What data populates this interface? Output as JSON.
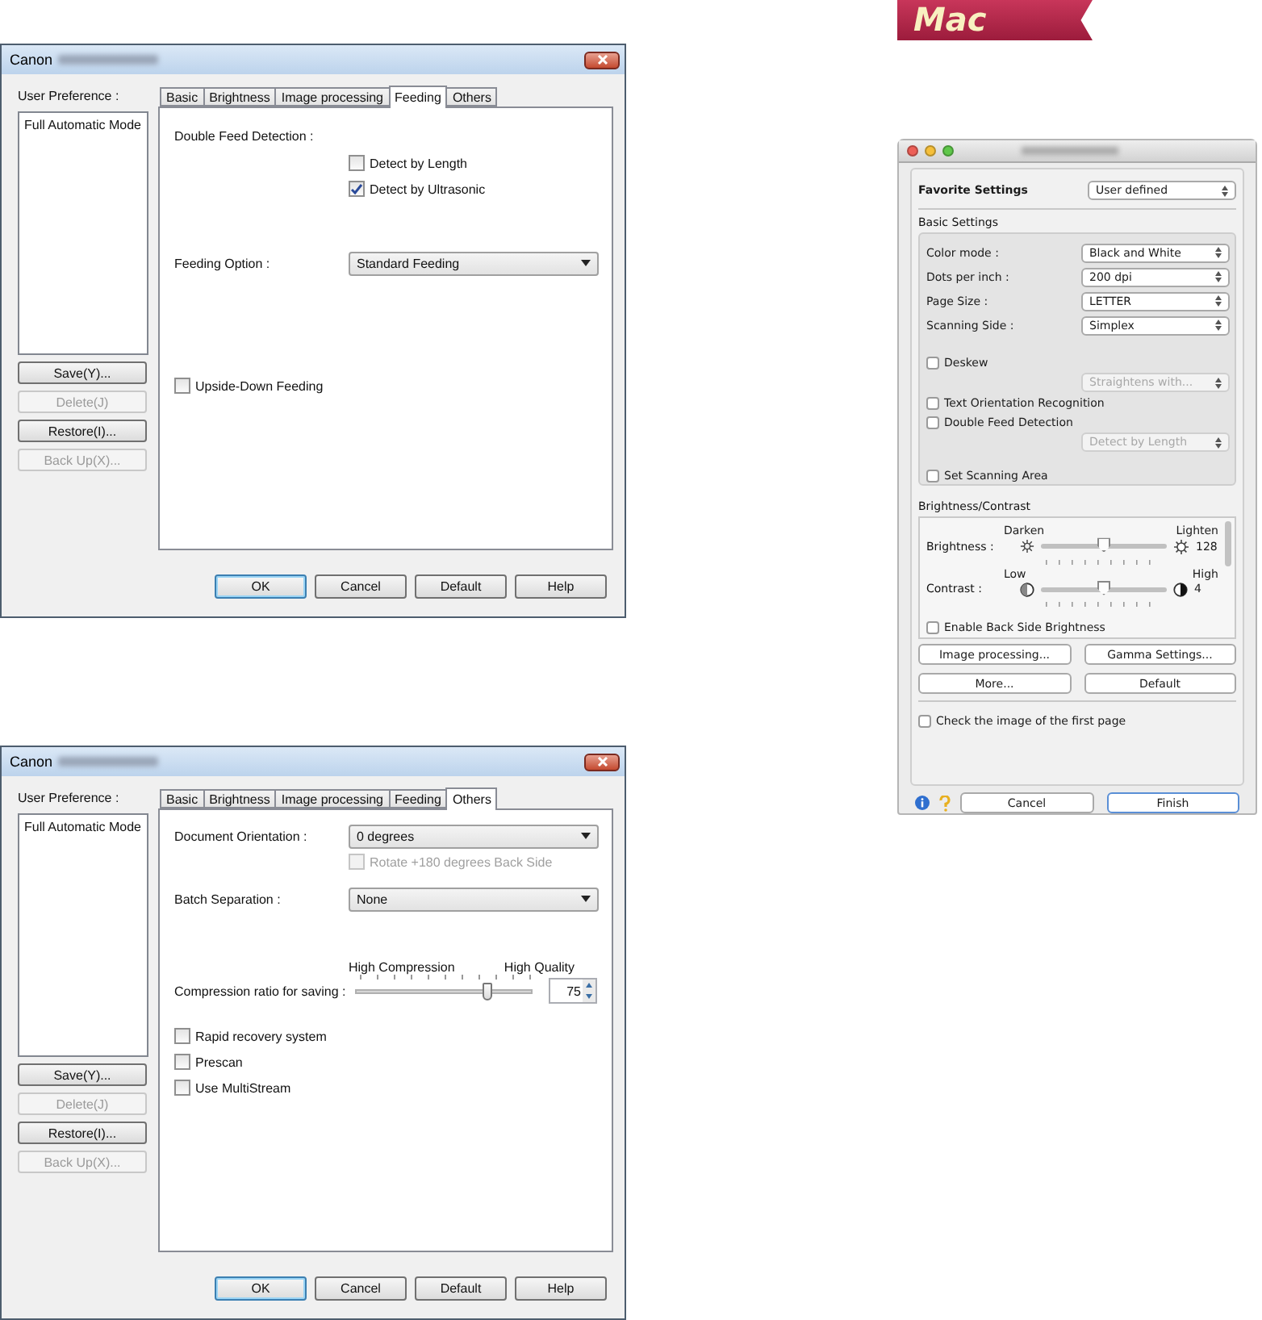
{
  "badge": {
    "label": "Mac"
  },
  "dialogs": [
    {
      "title": "Canon",
      "preference_label": "User Preference :",
      "preferences": [
        {
          "label": "Full Automatic Mode"
        }
      ],
      "side_buttons": [
        {
          "label": "Save(Y)...",
          "disabled": false
        },
        {
          "label": "Delete(J)",
          "disabled": true
        },
        {
          "label": "Restore(I)...",
          "disabled": false
        },
        {
          "label": "Back Up(X)...",
          "disabled": true
        }
      ],
      "tabs": [
        {
          "label": "Basic",
          "selected": false
        },
        {
          "label": "Brightness",
          "selected": false
        },
        {
          "label": "Image processing",
          "selected": false
        },
        {
          "label": "Feeding",
          "selected": true
        },
        {
          "label": "Others",
          "selected": false
        }
      ],
      "rows": [
        {
          "kind": "label",
          "label": "Double Feed Detection :"
        },
        {
          "kind": "option",
          "label": "Detect by Length",
          "checked": false,
          "disabled": false
        },
        {
          "kind": "option",
          "label": "Detect by Ultrasonic",
          "checked": true,
          "disabled": false
        },
        {
          "kind": "select",
          "label": "Feeding Option :",
          "value": "Standard Feeding"
        },
        {
          "kind": "checkbox",
          "label": "Upside-Down Feeding",
          "checked": false
        }
      ],
      "buttons": [
        {
          "label": "OK",
          "default": true
        },
        {
          "label": "Cancel",
          "default": false
        },
        {
          "label": "Default",
          "default": false
        },
        {
          "label": "Help",
          "default": false
        }
      ]
    },
    {
      "title": "Canon",
      "preference_label": "User Preference :",
      "preferences": [
        {
          "label": "Full Automatic Mode"
        }
      ],
      "side_buttons": [
        {
          "label": "Save(Y)...",
          "disabled": false
        },
        {
          "label": "Delete(J)",
          "disabled": true
        },
        {
          "label": "Restore(I)...",
          "disabled": false
        },
        {
          "label": "Back Up(X)...",
          "disabled": true
        }
      ],
      "tabs": [
        {
          "label": "Basic",
          "selected": false
        },
        {
          "label": "Brightness",
          "selected": false
        },
        {
          "label": "Image processing",
          "selected": false
        },
        {
          "label": "Feeding",
          "selected": false
        },
        {
          "label": "Others",
          "selected": true
        }
      ],
      "rows": [
        {
          "kind": "select",
          "label": "Document Orientation :",
          "value": "0 degrees"
        },
        {
          "kind": "option",
          "label": "Rotate +180 degrees Back Side",
          "checked": false,
          "disabled": true
        },
        {
          "kind": "select",
          "label": "Batch Separation :",
          "value": "None"
        },
        {
          "kind": "slider",
          "label": "Compression ratio for saving :",
          "min_label": "High Compression",
          "max_label": "High Quality",
          "level": 0.75,
          "value": "75"
        },
        {
          "kind": "checkbox",
          "label": "Rapid recovery system",
          "checked": false
        },
        {
          "kind": "checkbox",
          "label": "Prescan",
          "checked": false
        },
        {
          "kind": "checkbox",
          "label": "Use MultiStream",
          "checked": false
        }
      ],
      "buttons": [
        {
          "label": "OK",
          "default": true
        },
        {
          "label": "Cancel",
          "default": false
        },
        {
          "label": "Default",
          "default": false
        },
        {
          "label": "Help",
          "default": false
        }
      ]
    }
  ],
  "mac_window": {
    "favorite": {
      "label": "Favorite Settings",
      "value": "User defined"
    },
    "basic_heading": "Basic Settings",
    "basic_rows": [
      {
        "kind": "popup",
        "label": "Color mode :",
        "value": "Black and White"
      },
      {
        "kind": "popup",
        "label": "Dots per inch :",
        "value": "200 dpi"
      },
      {
        "kind": "popup",
        "label": "Page Size :",
        "value": "LETTER"
      },
      {
        "kind": "popup",
        "label": "Scanning Side :",
        "value": "Simplex"
      },
      {
        "kind": "checkbox",
        "label": "Deskew",
        "checked": false
      },
      {
        "kind": "subpopup",
        "value": "Straightens with...",
        "disabled": true
      },
      {
        "kind": "checkbox",
        "label": "Text Orientation Recognition",
        "checked": false
      },
      {
        "kind": "checkbox",
        "label": "Double Feed Detection",
        "checked": false
      },
      {
        "kind": "subpopup",
        "value": "Detect by Length",
        "disabled": true
      },
      {
        "kind": "checkbox",
        "label": "Set Scanning Area",
        "checked": false
      }
    ],
    "bc_heading": "Brightness/Contrast",
    "sliders": [
      {
        "label": "Brightness :",
        "min_label": "Darken",
        "max_label": "Lighten",
        "kind": "brightness",
        "level": 0.5,
        "value": "128"
      },
      {
        "label": "Contrast :",
        "min_label": "Low",
        "max_label": "High",
        "kind": "contrast",
        "level": 0.5,
        "value": "4"
      }
    ],
    "cut_checkbox": {
      "label": "Enable Back Side Brightness",
      "checked": false
    },
    "buttons": [
      {
        "label": "Image processing..."
      },
      {
        "label": "Gamma Settings..."
      },
      {
        "label": "More..."
      },
      {
        "label": "Default"
      }
    ],
    "first_page_check": {
      "label": "Check the image of the first page",
      "checked": false
    },
    "footer_buttons": [
      {
        "label": "Cancel",
        "default": false
      },
      {
        "label": "Finish",
        "default": true
      }
    ]
  }
}
